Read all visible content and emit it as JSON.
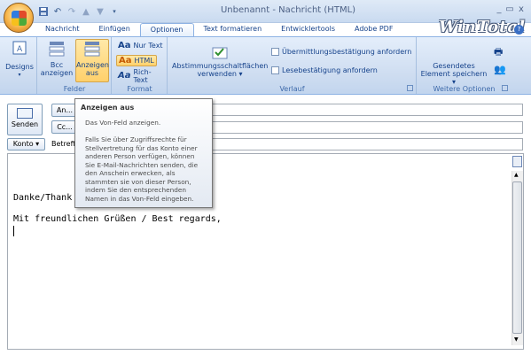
{
  "window": {
    "title": "Unbenannt - Nachricht (HTML)",
    "minimize": "_",
    "restore": "▭",
    "close": "x"
  },
  "watermark": "WinTotal",
  "tabs": [
    "Nachricht",
    "Einfügen",
    "Optionen",
    "Text formatieren",
    "Entwicklertools",
    "Adobe PDF"
  ],
  "active_tab": "Optionen",
  "ribbon": {
    "designs_label": "Designs",
    "felder": {
      "label": "Felder",
      "bcc_line1": "Bcc",
      "bcc_line2": "anzeigen",
      "von_line1": "Anzeigen",
      "von_line2": "aus"
    },
    "format": {
      "label": "Format",
      "plain": "Nur Text",
      "html": "HTML",
      "rich": "Rich-Text",
      "glyph": "Aa"
    },
    "verlauf": {
      "label": "Verlauf",
      "vote_line1": "Abstimmungsschaltflächen",
      "vote_line2": "verwenden ▾",
      "delivery": "Übermittlungsbestätigung anfordern",
      "read": "Lesebestätigung anfordern"
    },
    "weitere": {
      "label": "Weitere Optionen",
      "sent_line1": "Gesendetes",
      "sent_line2": "Element speichern ▾"
    }
  },
  "header": {
    "send": "Senden",
    "to_button": "An...",
    "cc_button": "Cc...",
    "account_button": "Konto ▾",
    "subject_label": "Betreff:"
  },
  "body": {
    "line_thanks": "Danke/Thank",
    "line_regards": "Mit freundlichen Grüßen / Best regards,"
  },
  "tooltip": {
    "title": "Anzeigen aus",
    "summary": "Das Von-Feld anzeigen.",
    "detail_lines": [
      "Falls Sie über Zugriffsrechte für",
      "Stellvertretung für das Konto einer",
      "anderen Person verfügen, können",
      "Sie E-Mail-Nachrichten senden, die",
      "den Anschein erwecken, als",
      "stammten sie von dieser Person,",
      "indem Sie den entsprechenden",
      "Namen in das Von-Feld eingeben."
    ]
  },
  "colors": {
    "ribbon": "#cddcf0",
    "selected": "#ffd06b",
    "text": "#15428b"
  }
}
